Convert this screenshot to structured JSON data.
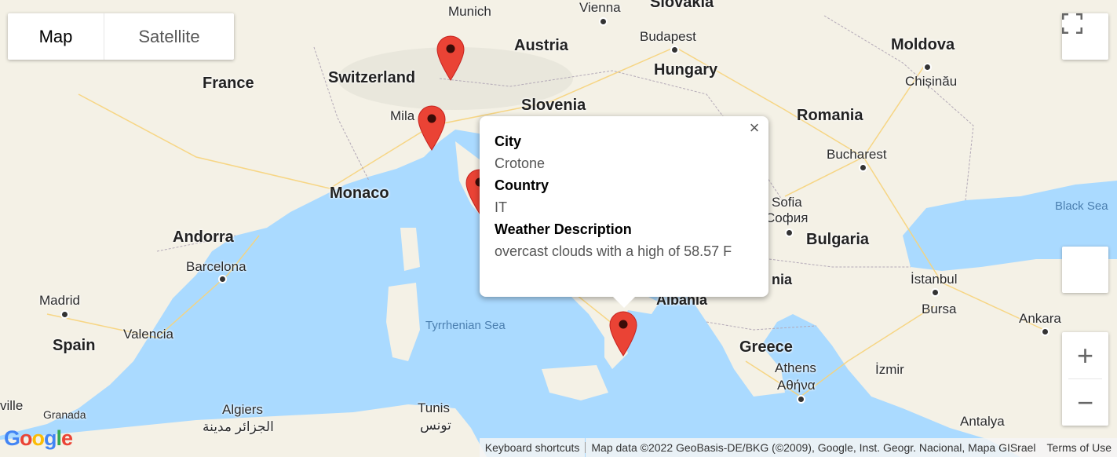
{
  "map_type": {
    "map_label": "Map",
    "satellite_label": "Satellite",
    "selected": "Map"
  },
  "countries": [
    "France",
    "Switzerland",
    "Austria",
    "Hungary",
    "Slovenia",
    "Moldova",
    "Romania",
    "Monaco",
    "Andorra",
    "Spain",
    "Bulgaria",
    "Albania",
    "Greece"
  ],
  "cities": [
    "Munich",
    "Vienna",
    "Budapest",
    "Chișinău",
    "Mila",
    "Bucharest",
    "Sofia",
    "София",
    "Barcelona",
    "Madrid",
    "Valencia",
    "İstanbul",
    "Bursa",
    "Ankara",
    "Athens",
    "Αθήνα",
    "İzmir",
    "Algiers",
    "الجزائر مدينة",
    "Tunis",
    "تونس",
    "Antalya",
    "Granada",
    "ville"
  ],
  "partial_labels": {
    "slovakia": "Slovakia",
    "albania_part": "nia"
  },
  "seas": [
    "Tyrrhenian Sea",
    "Black Sea"
  ],
  "info_window": {
    "fields": [
      {
        "key": "City",
        "value": "Crotone"
      },
      {
        "key": "Country",
        "value": "IT"
      },
      {
        "key": "Weather Description",
        "value": "overcast clouds with a high of 58.57 F"
      }
    ],
    "close_icon": "close-icon"
  },
  "markers": [
    {
      "name": "marker-1"
    },
    {
      "name": "marker-2"
    },
    {
      "name": "marker-3"
    },
    {
      "name": "marker-crotone"
    }
  ],
  "controls": {
    "zoom_in": "+",
    "zoom_out": "−"
  },
  "footer": {
    "keyboard": "Keyboard shortcuts",
    "map_data": "Map data ©2022 GeoBasis-DE/BKG (©2009), Google, Inst. Geogr. Nacional, Mapa GISrael",
    "terms": "Terms of Use"
  },
  "logo": "Google",
  "colors": {
    "water": "#aadaff",
    "land": "#f4f1e6",
    "marker": "#ea4335",
    "accent": "#4285f4"
  }
}
